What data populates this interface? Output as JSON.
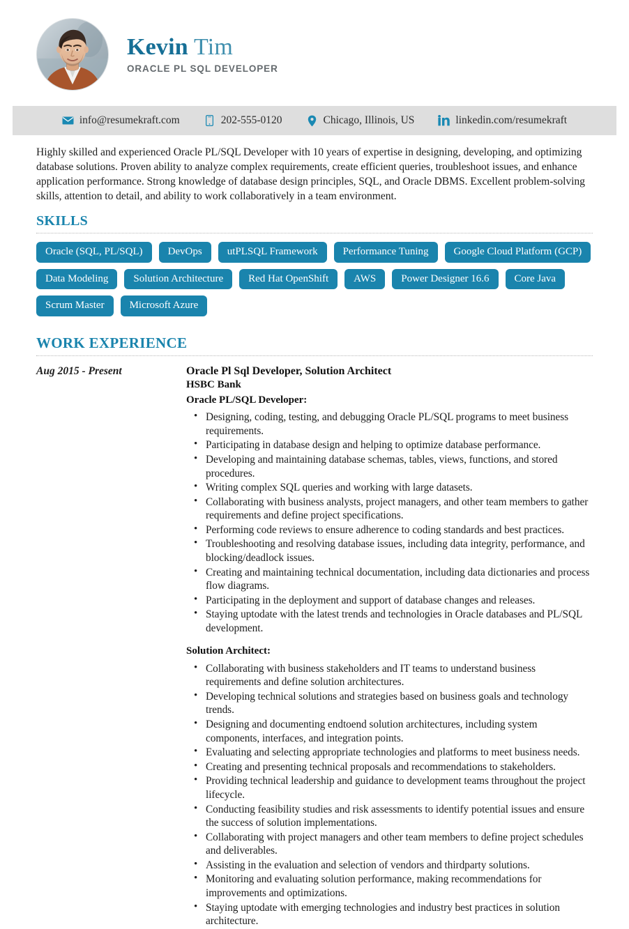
{
  "theme": {
    "accent": "#1a84ad",
    "name_first_color": "#166f96",
    "name_last_color": "#3f8fae",
    "contact_bar_bg": "#dedede",
    "pill_bg": "#1a84ad",
    "pill_text": "#ffffff"
  },
  "header": {
    "first_name": "Kevin",
    "last_name": "Tim",
    "job_title": "ORACLE PL SQL DEVELOPER",
    "avatar_alt": "profile-photo"
  },
  "contact": {
    "items": [
      {
        "icon": "envelope-icon",
        "value": "info@resumekraft.com"
      },
      {
        "icon": "phone-icon",
        "value": "202-555-0120"
      },
      {
        "icon": "location-pin-icon",
        "value": "Chicago, Illinois, US"
      },
      {
        "icon": "linkedin-icon",
        "value": "linkedin.com/resumekraft"
      }
    ]
  },
  "summary": {
    "text": "Highly skilled and experienced Oracle PL/SQL Developer with 10 years of expertise in designing, developing, and optimizing database solutions. Proven ability to analyze complex requirements, create efficient queries, troubleshoot issues, and enhance application performance. Strong knowledge of database design principles, SQL, and Oracle DBMS. Excellent problem-solving skills, attention to detail, and ability to work collaboratively in a team environment."
  },
  "skills": {
    "title": "SKILLS",
    "items": [
      "Oracle (SQL, PL/SQL)",
      "DevOps",
      "utPLSQL Framework",
      "Performance Tuning",
      "Google Cloud Platform (GCP)",
      "Data Modeling",
      "Solution Architecture",
      "Red Hat OpenShift",
      "AWS",
      "Power Designer 16.6",
      "Core Java",
      "Scrum Master",
      "Microsoft Azure"
    ]
  },
  "experience": {
    "title": "WORK EXPERIENCE",
    "entries": [
      {
        "date": "Aug 2015 - Present",
        "role": "Oracle Pl Sql Developer, Solution Architect",
        "company": "HSBC Bank",
        "groups": [
          {
            "subhead": "Oracle PL/SQL Developer:",
            "bullets": [
              "Designing, coding, testing, and debugging Oracle PL/SQL programs to meet business requirements.",
              "Participating in database design and helping to optimize database performance.",
              "Developing and maintaining database schemas, tables, views, functions, and stored procedures.",
              "Writing complex SQL queries and working with large datasets.",
              "Collaborating with business analysts, project managers, and other team members to gather requirements and define project specifications.",
              "Performing code reviews to ensure adherence to coding standards and best practices.",
              "Troubleshooting and resolving database issues, including data integrity, performance, and blocking/deadlock issues.",
              "Creating and maintaining technical documentation, including data dictionaries and process flow diagrams.",
              "Participating in the deployment and support of database changes and releases.",
              "Staying uptodate with the latest trends and technologies in Oracle databases and PL/SQL development."
            ]
          },
          {
            "subhead": "Solution Architect:",
            "bullets": [
              "Collaborating with business stakeholders and IT teams to understand business requirements and define solution architectures.",
              "Developing technical solutions and strategies based on business goals and technology trends.",
              "Designing and documenting endtoend solution architectures, including system components, interfaces, and integration points.",
              "Evaluating and selecting appropriate technologies and platforms to meet business needs.",
              "Creating and presenting technical proposals and recommendations to stakeholders.",
              "Providing technical leadership and guidance to development teams throughout the project lifecycle.",
              "Conducting feasibility studies and risk assessments to identify potential issues and ensure the success of solution implementations.",
              "Collaborating with project managers and other team members to define project schedules and deliverables.",
              "Assisting in the evaluation and selection of vendors and thirdparty solutions.",
              "Monitoring and evaluating solution performance, making recommendations for improvements and optimizations.",
              "Staying uptodate with emerging technologies and industry best practices in solution architecture."
            ]
          }
        ]
      }
    ]
  }
}
